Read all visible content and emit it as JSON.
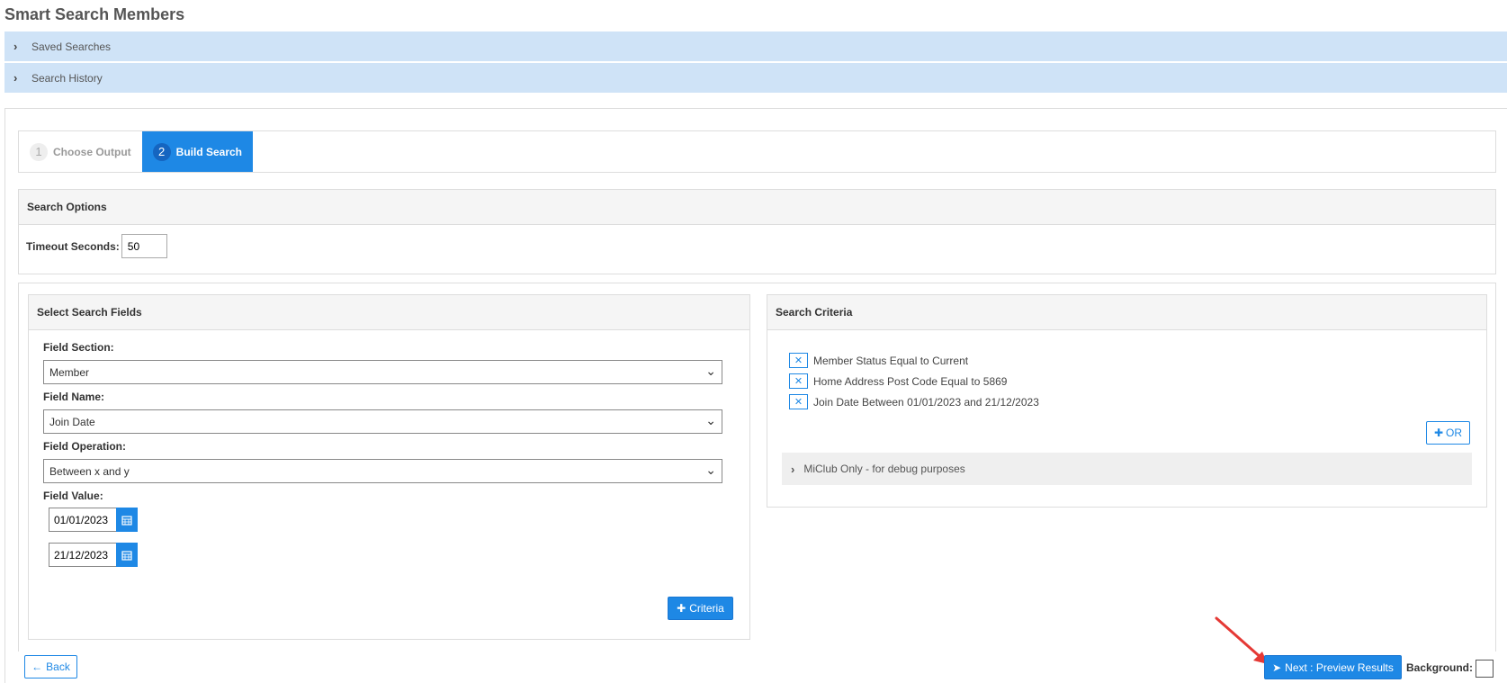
{
  "page_title": "Smart Search Members",
  "accordions": {
    "saved_searches": "Saved Searches",
    "search_history": "Search History"
  },
  "wizard": {
    "steps": [
      {
        "num": "1",
        "label": "Choose Output"
      },
      {
        "num": "2",
        "label": "Build Search"
      }
    ]
  },
  "search_options": {
    "title": "Search Options",
    "timeout_label": "Timeout Seconds:",
    "timeout_value": "50"
  },
  "select_fields": {
    "title": "Select Search Fields",
    "field_section_label": "Field Section:",
    "field_section_value": "Member",
    "field_name_label": "Field Name:",
    "field_name_value": "Join Date",
    "field_operation_label": "Field Operation:",
    "field_operation_value": "Between x and y",
    "field_value_label": "Field Value:",
    "date_from": "01/01/2023",
    "date_to": "21/12/2023",
    "add_criteria_label": "Criteria"
  },
  "search_criteria": {
    "title": "Search Criteria",
    "items": [
      "Member Status Equal to Current",
      "Home Address Post Code Equal to 5869",
      "Join Date Between 01/01/2023 and 21/12/2023"
    ],
    "or_label": "OR",
    "debug_label": "MiClub Only - for debug purposes"
  },
  "footer": {
    "back_label": "Back",
    "next_label": "Next : Preview Results",
    "background_label": "Background:"
  },
  "colors": {
    "accent": "#1e88e5",
    "accordion_bg": "#cfe3f7",
    "annotation_arrow": "#e53935"
  }
}
